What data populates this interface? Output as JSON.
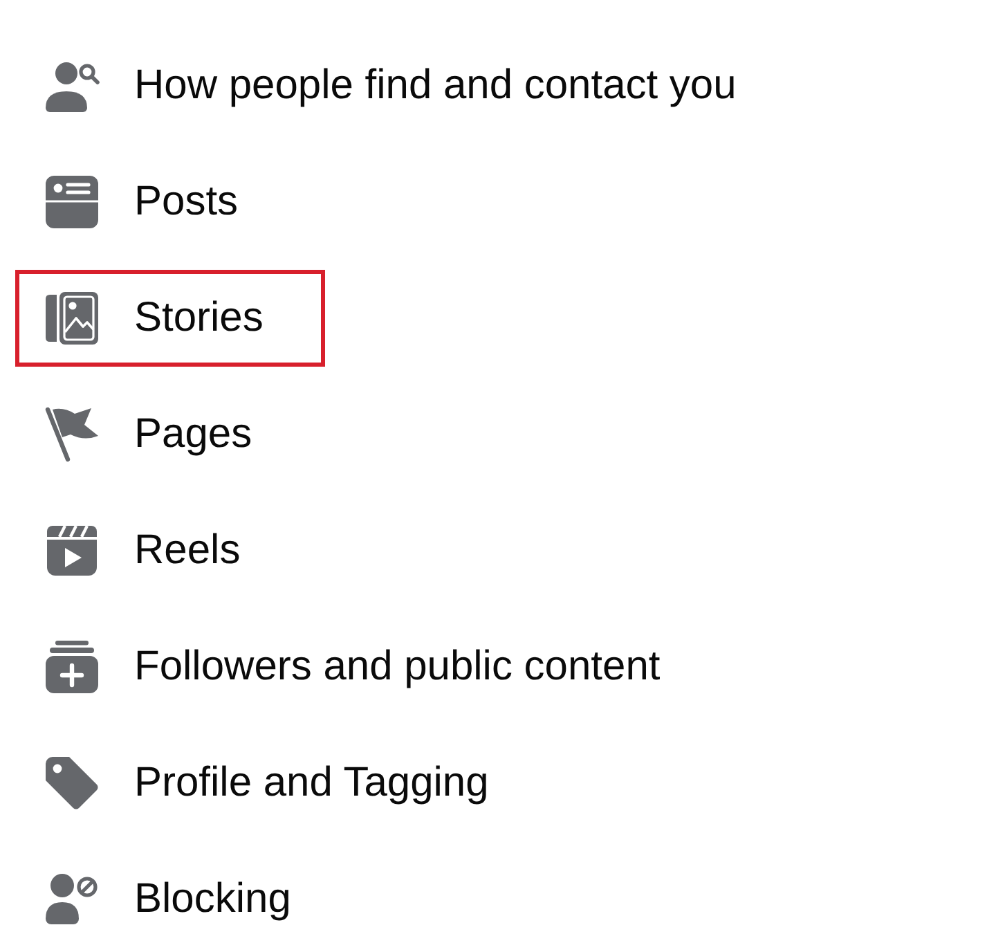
{
  "items": [
    {
      "label": "How people find and contact you",
      "highlighted": false
    },
    {
      "label": "Posts",
      "highlighted": false
    },
    {
      "label": "Stories",
      "highlighted": true
    },
    {
      "label": "Pages",
      "highlighted": false
    },
    {
      "label": "Reels",
      "highlighted": false
    },
    {
      "label": "Followers and public content",
      "highlighted": false
    },
    {
      "label": "Profile and Tagging",
      "highlighted": false
    },
    {
      "label": "Blocking",
      "highlighted": false
    }
  ]
}
